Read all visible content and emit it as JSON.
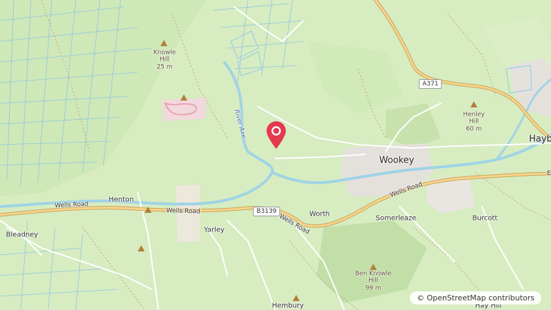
{
  "map": {
    "places": {
      "wookey": "Wookey",
      "henton": "Henton",
      "bleadney": "Bleadney",
      "yarley": "Yarley",
      "worth": "Worth",
      "somerleaze": "Somerleaze",
      "burcott": "Burcott",
      "hembury": "Hembury",
      "hay_bridge": "Hayb",
      "hay_hill": "Hay Hill"
    },
    "peaks": {
      "knowle_hill": [
        "Knowle",
        "Hill",
        "25 m"
      ],
      "henley_hill": [
        "Henley",
        "Hill",
        "60 m"
      ],
      "ben_knowle_hill": [
        "Ben Knowle",
        "Hill",
        "99 m"
      ]
    },
    "roads": {
      "wells_road": "Wells Road",
      "b3139": "B3139",
      "a371": "A371",
      "east_edge": "E"
    },
    "river": "River Axe",
    "attribution": {
      "symbol": "©",
      "text": "OpenStreetMap contributors"
    }
  },
  "colors": {
    "land": "#d7ecc1",
    "water": "#9fd3e6",
    "major_road": "#f7d58b",
    "major_road_casing": "#c9a35a",
    "minor_road": "#ffffff",
    "marker": "#e53950",
    "peak_marker": "#b07f3a"
  },
  "icons": {
    "marker": "map-pin-icon",
    "peak": "peak-triangle-icon"
  }
}
